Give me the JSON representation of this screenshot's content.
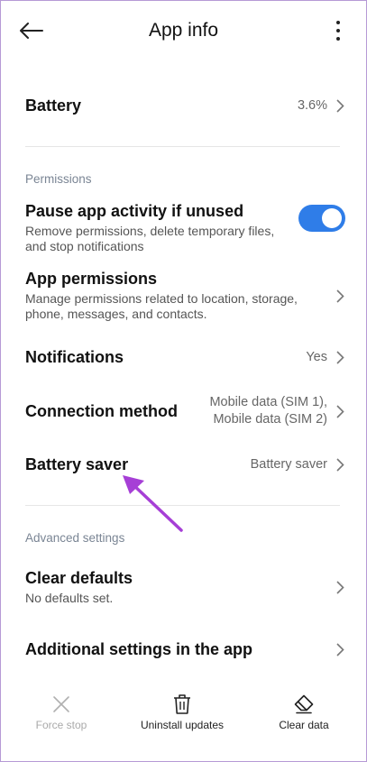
{
  "header": {
    "title": "App info"
  },
  "battery": {
    "label": "Battery",
    "value": "3.6%"
  },
  "permissions": {
    "section_label": "Permissions",
    "pause": {
      "label": "Pause app activity if unused",
      "desc": "Remove permissions, delete temporary files, and stop notifications",
      "toggle_on": true
    },
    "app_permissions": {
      "label": "App permissions",
      "desc": "Manage permissions related to location, storage, phone, messages, and contacts."
    },
    "notifications": {
      "label": "Notifications",
      "value": "Yes"
    },
    "connection": {
      "label": "Connection method",
      "value_line1": "Mobile data (SIM 1),",
      "value_line2": "Mobile data (SIM 2)"
    },
    "battery_saver": {
      "label": "Battery saver",
      "value": "Battery saver"
    }
  },
  "advanced": {
    "section_label": "Advanced settings",
    "clear_defaults": {
      "label": "Clear defaults",
      "desc": "No defaults set."
    },
    "additional": {
      "label": "Additional settings in the app"
    }
  },
  "bottom": {
    "force_stop": "Force stop",
    "uninstall_updates": "Uninstall updates",
    "clear_data": "Clear data"
  },
  "colors": {
    "accent": "#2f7de8",
    "annotation_arrow": "#a63fd6"
  }
}
